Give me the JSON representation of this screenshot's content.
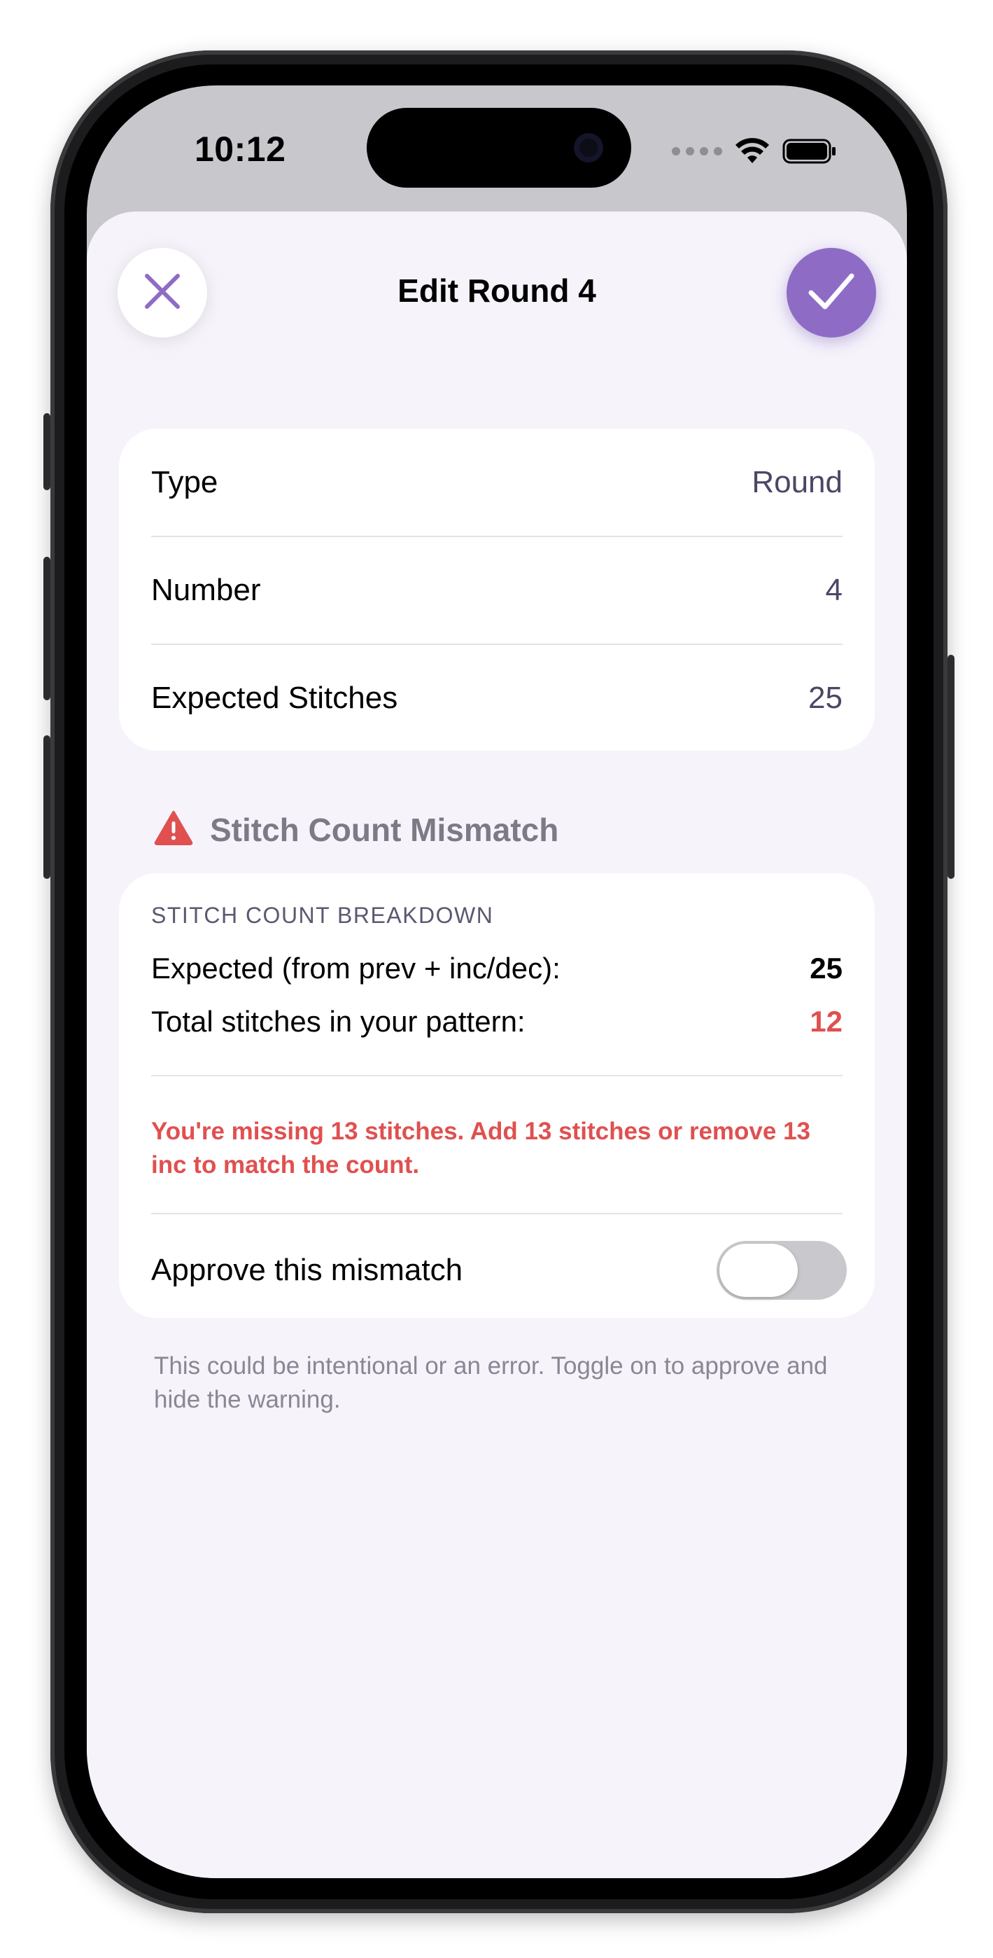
{
  "status_bar": {
    "time": "10:12"
  },
  "header": {
    "title": "Edit Round 4",
    "close_icon": "close-x-icon",
    "confirm_icon": "checkmark-icon"
  },
  "details": {
    "rows": [
      {
        "label": "Type",
        "value": "Round"
      },
      {
        "label": "Number",
        "value": "4"
      },
      {
        "label": "Expected Stitches",
        "value": "25"
      }
    ]
  },
  "mismatch": {
    "title": "Stitch Count Mismatch",
    "icon": "warning-triangle-icon",
    "caption": "STITCH COUNT BREAKDOWN",
    "expected_label": "Expected (from prev + inc/dec):",
    "expected_value": "25",
    "total_label": "Total stitches in your pattern:",
    "total_value": "12",
    "message": "You're missing 13 stitches. Add 13 stitches or remove 13 inc to match the count.",
    "approve_label": "Approve this mismatch",
    "approve_on": false,
    "footnote": "This could be intentional or an error. Toggle on to approve and hide the warning."
  },
  "colors": {
    "accent": "#8e6cc5",
    "error": "#e05050",
    "sheet_bg": "#f6f3fb"
  }
}
